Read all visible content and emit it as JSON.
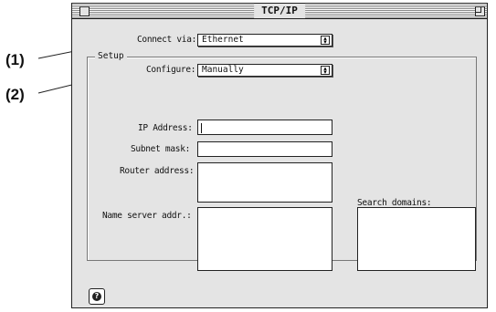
{
  "callouts": {
    "one": "(1)",
    "two": "(2)"
  },
  "window": {
    "title": "TCP/IP"
  },
  "connect": {
    "label": "Connect via:",
    "value": "Ethernet"
  },
  "setup": {
    "title": "Setup"
  },
  "configure": {
    "label": "Configure:",
    "value": "Manually"
  },
  "fields": {
    "ip_label": "IP Address:",
    "subnet_label": "Subnet mask:",
    "router_label": "Router address:",
    "nameserver_label": "Name server addr.:",
    "search_label": "Search domains:"
  },
  "help": {
    "glyph": "?"
  },
  "icons": {
    "popup": "up-down-arrows-icon",
    "close": "close-box-icon",
    "zoom": "zoom-box-icon",
    "help": "help-icon"
  }
}
